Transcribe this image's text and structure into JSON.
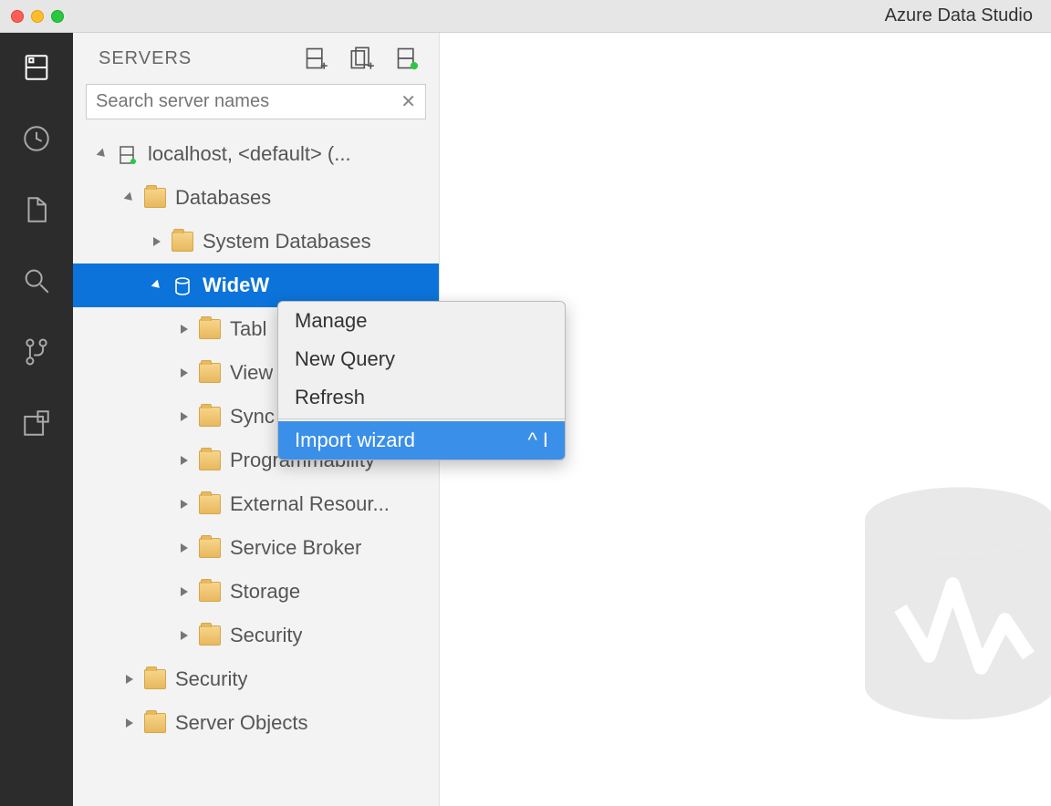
{
  "window": {
    "title": "Azure Data Studio"
  },
  "sidebar": {
    "title": "SERVERS",
    "search_placeholder": "Search server names"
  },
  "tree": {
    "server": "localhost, <default> (...",
    "databases": "Databases",
    "system_db": "System Databases",
    "wideworld": "WideW",
    "tables": "Tabl",
    "views": "View",
    "synonyms": "Sync",
    "programmability": "Programmability",
    "external_resources": "External Resour...",
    "service_broker": "Service Broker",
    "storage": "Storage",
    "db_security": "Security",
    "security": "Security",
    "server_objects": "Server Objects"
  },
  "context_menu": {
    "manage": "Manage",
    "new_query": "New Query",
    "refresh": "Refresh",
    "import_wizard": "Import wizard",
    "import_shortcut": "^ I"
  }
}
